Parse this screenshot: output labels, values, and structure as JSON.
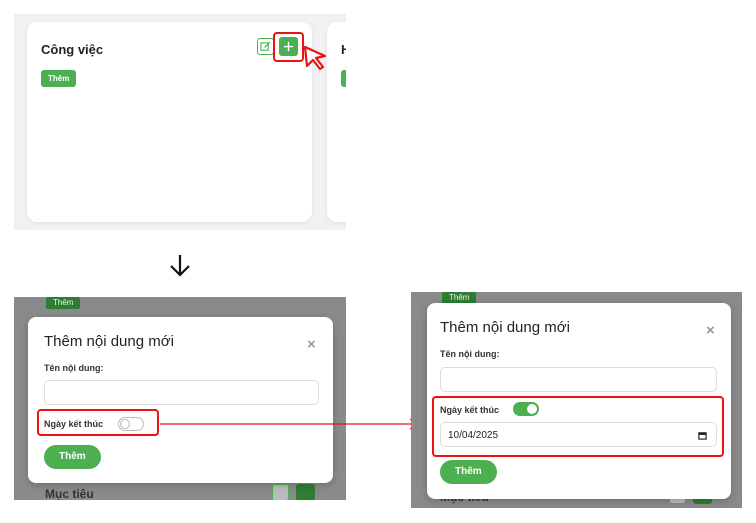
{
  "board": {
    "column1": {
      "title": "Công việc",
      "add_label": "Thêm"
    },
    "column2": {
      "title_partial": "H"
    }
  },
  "modal": {
    "title": "Thêm nội dung mới",
    "close": "×",
    "name_label": "Tên nội dung:",
    "name_value": "",
    "end_date_label": "Ngày kết thúc",
    "end_date_value": "10/04/2025",
    "submit_label": "Thêm"
  },
  "background": {
    "chip_label": "Thêm",
    "next_column_title": "Mục tiêu"
  },
  "colors": {
    "accent": "#4caf50",
    "highlight": "#e11111",
    "overlay": "#8a8a8a"
  },
  "icons": [
    "edit-icon",
    "plus-icon",
    "cursor-arrow-icon",
    "down-arrow-icon",
    "calendar-icon",
    "close-icon"
  ],
  "states": {
    "panel2_toggle_on": false,
    "panel3_toggle_on": true
  }
}
